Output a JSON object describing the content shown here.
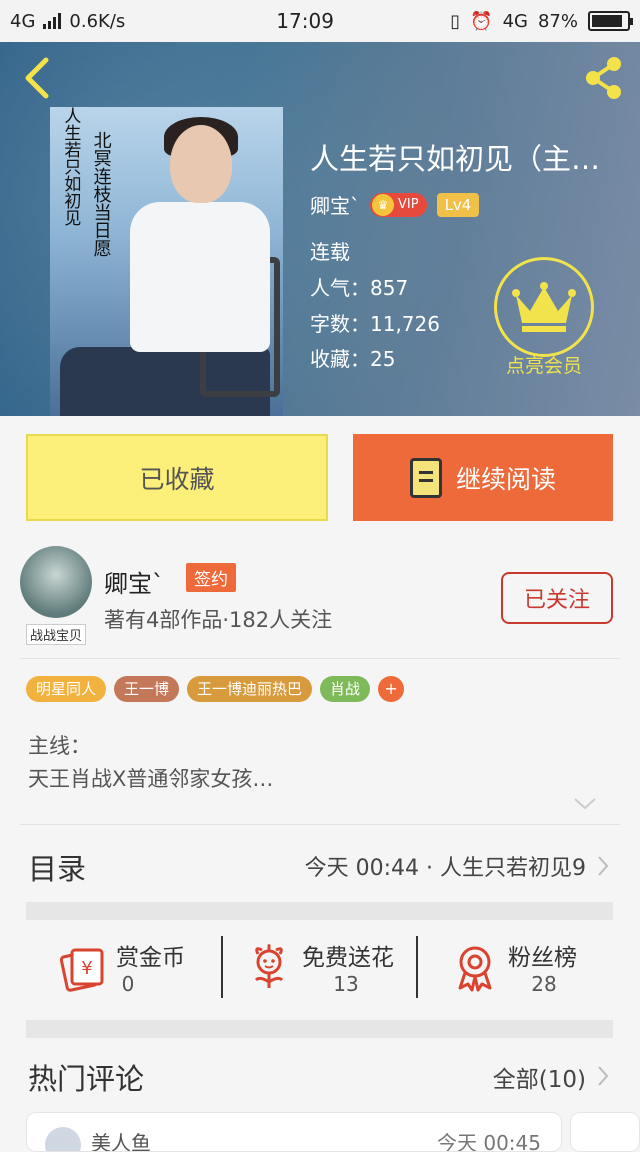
{
  "status_bar": {
    "network": "4G",
    "speed": "0.6K/s",
    "time": "17:09",
    "network2": "4G",
    "battery": "87%",
    "battery_level": 0.87
  },
  "book": {
    "title": "人生若只如初见（主…",
    "author": "卿宝`",
    "vip_label": "VIP",
    "level": "Lv4",
    "serial_status": "连载",
    "popularity": "人气：857",
    "word_count": "字数：11,726",
    "favorites": "收藏：25",
    "member_label": "点亮会员",
    "cover_text_1": "人生若只如初见",
    "cover_text_2": "北冥连枝当日愿"
  },
  "actions": {
    "favorited_label": "已收藏",
    "continue_label": "继续阅读"
  },
  "author_card": {
    "name": "卿宝`",
    "sign_badge": "签约",
    "meta": "著有4部作品·182人关注",
    "follow_label": "已关注",
    "avatar_tag": "战战宝贝"
  },
  "tags": [
    {
      "label": "明星同人",
      "color": "#f2b23f"
    },
    {
      "label": "王一博",
      "color": "#c4785a"
    },
    {
      "label": "王一博迪丽热巴",
      "color": "#d79a3c"
    },
    {
      "label": "肖战",
      "color": "#7fba5a"
    }
  ],
  "tag_more": "+",
  "summary": {
    "line1": "主线：",
    "line2": "天王肖战X普通邻家女孩…"
  },
  "toc": {
    "title": "目录",
    "latest": "今天 00:44 · 人生只若初见9"
  },
  "rewards": [
    {
      "label": "赏金币",
      "count": "0",
      "icon": "coin-envelope-icon"
    },
    {
      "label": "免费送花",
      "count": "13",
      "icon": "flower-icon"
    },
    {
      "label": "粉丝榜",
      "count": "28",
      "icon": "ribbon-award-icon"
    }
  ],
  "hot_comments": {
    "title": "热门评论",
    "all_label": "全部(10)",
    "first_name": "美人鱼",
    "first_time": "今天 00:45"
  },
  "colors": {
    "accent_orange": "#ef6a3a",
    "fav_yellow": "#fcf07a",
    "member_yellow": "#f2e24b",
    "follow_red": "#c83a2e"
  }
}
